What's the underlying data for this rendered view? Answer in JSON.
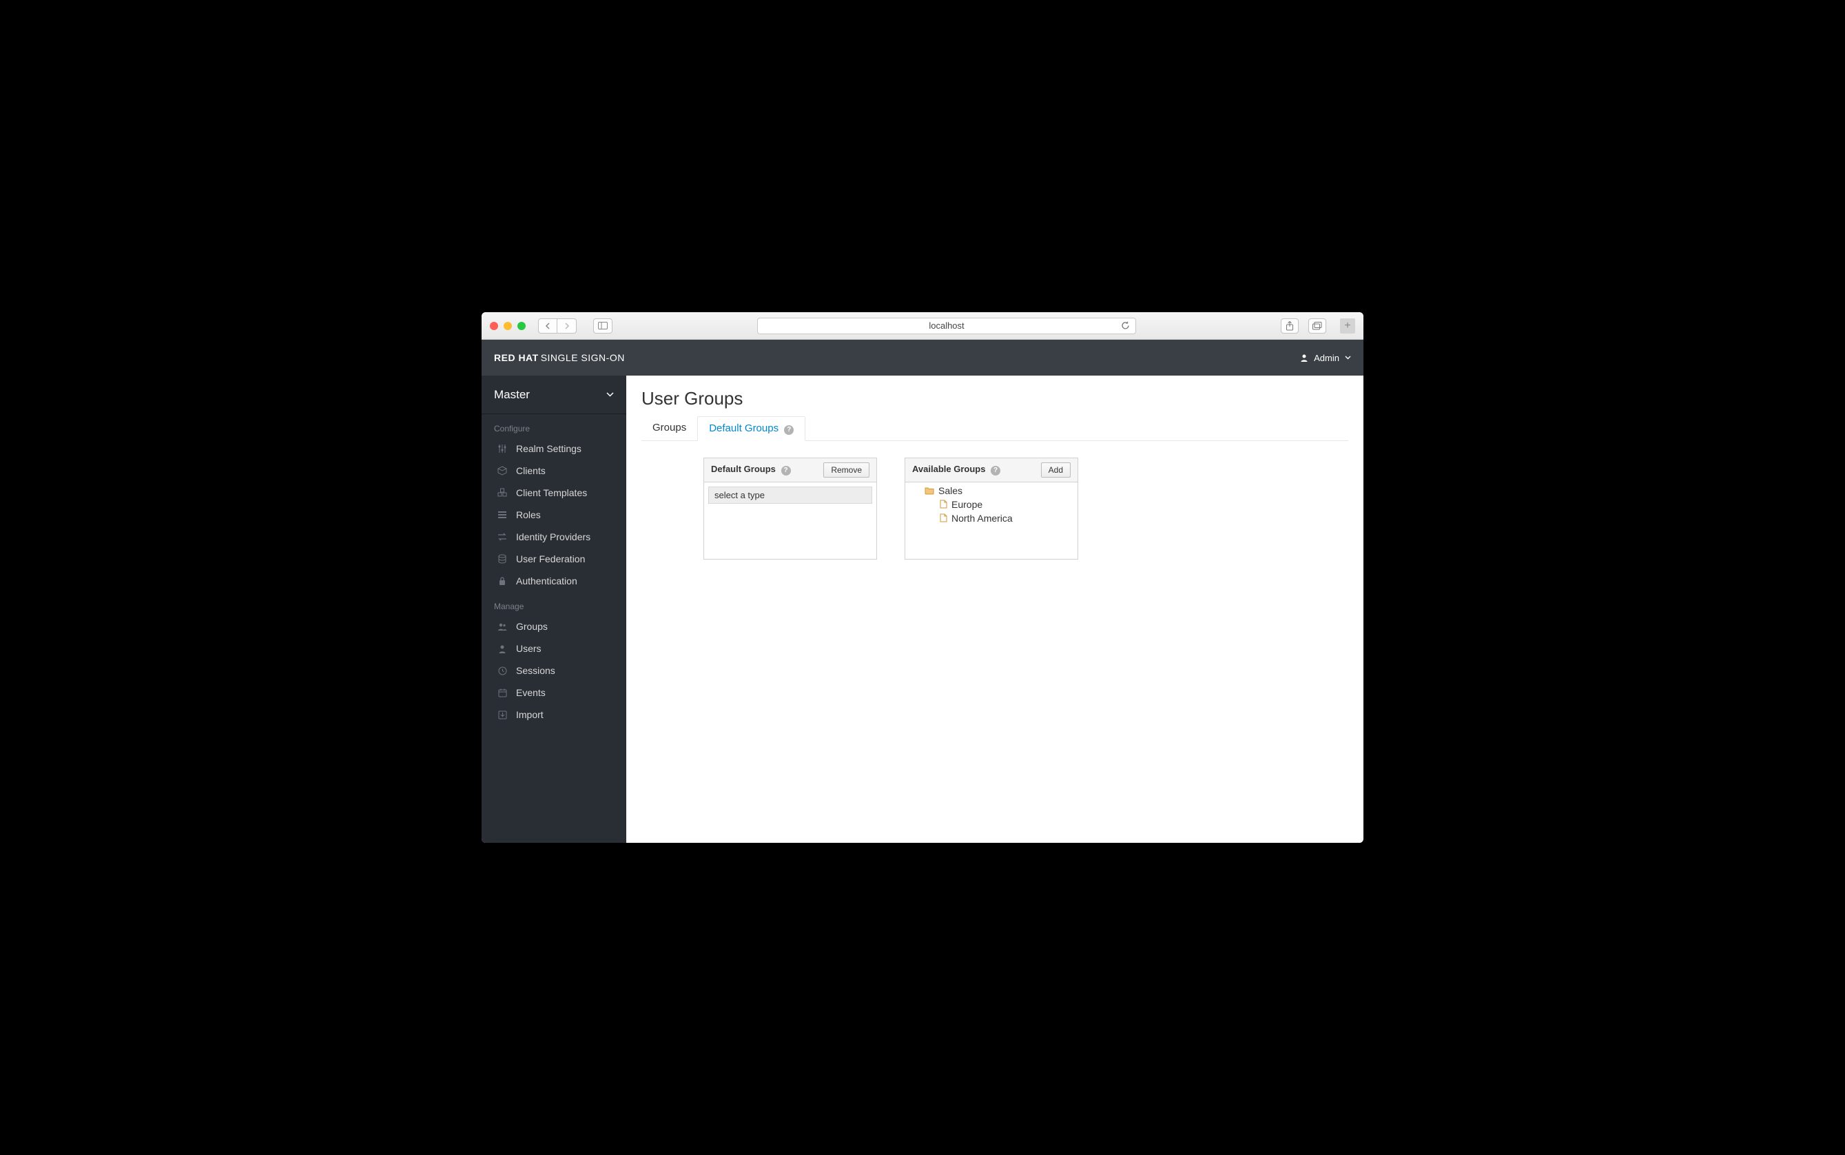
{
  "browser": {
    "url": "localhost"
  },
  "header": {
    "brand_bold": "RED HAT",
    "brand_rest": " SINGLE SIGN-ON",
    "user_label": "Admin"
  },
  "sidebar": {
    "realm": "Master",
    "configure_label": "Configure",
    "manage_label": "Manage",
    "configure_items": [
      {
        "label": "Realm Settings"
      },
      {
        "label": "Clients"
      },
      {
        "label": "Client Templates"
      },
      {
        "label": "Roles"
      },
      {
        "label": "Identity Providers"
      },
      {
        "label": "User Federation"
      },
      {
        "label": "Authentication"
      }
    ],
    "manage_items": [
      {
        "label": "Groups"
      },
      {
        "label": "Users"
      },
      {
        "label": "Sessions"
      },
      {
        "label": "Events"
      },
      {
        "label": "Import"
      }
    ]
  },
  "main": {
    "title": "User Groups",
    "tabs": [
      {
        "label": "Groups"
      },
      {
        "label": "Default Groups"
      }
    ],
    "default_panel": {
      "title": "Default Groups",
      "button": "Remove",
      "placeholder": "select a type"
    },
    "available_panel": {
      "title": "Available Groups",
      "button": "Add",
      "tree": {
        "root": "Sales",
        "children": [
          "Europe",
          "North America"
        ]
      }
    }
  }
}
